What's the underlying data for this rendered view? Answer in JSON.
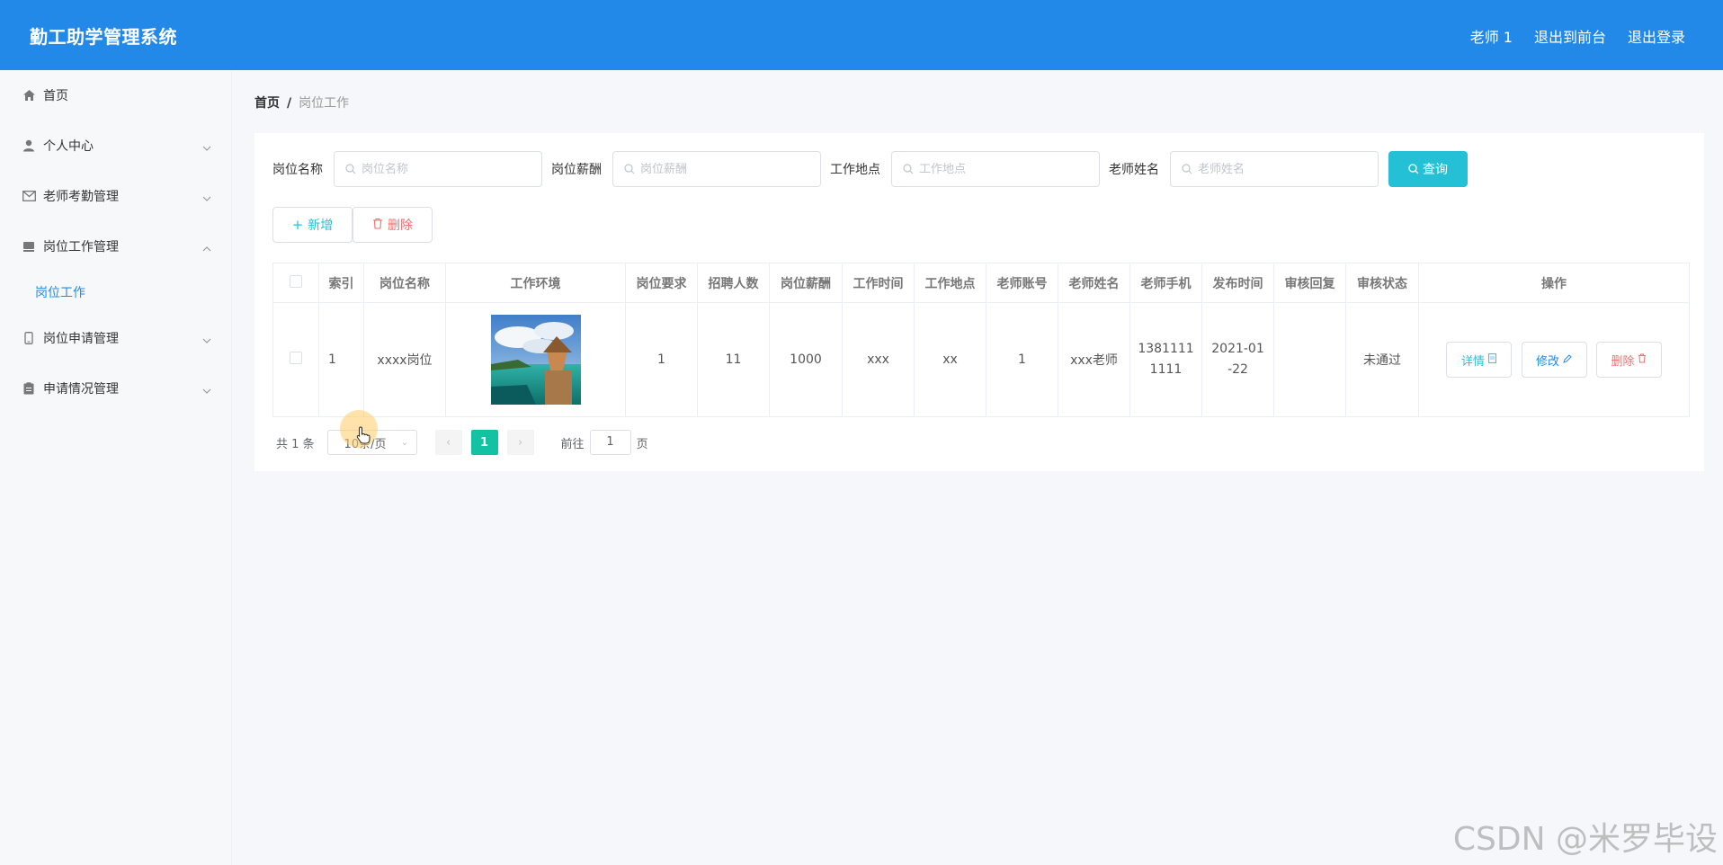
{
  "header": {
    "title": "勤工助学管理系统",
    "nav": [
      "老师 1",
      "退出到前台",
      "退出登录"
    ]
  },
  "sidebar": {
    "items": [
      {
        "label": "首页",
        "icon": "home-icon"
      },
      {
        "label": "个人中心",
        "icon": "user-icon"
      },
      {
        "label": "老师考勤管理",
        "icon": "mail-icon"
      },
      {
        "label": "岗位工作管理",
        "icon": "briefcase-icon",
        "expanded": true
      },
      {
        "label": "岗位工作",
        "icon": ""
      },
      {
        "label": "岗位申请管理",
        "icon": "phone-icon"
      },
      {
        "label": "申请情况管理",
        "icon": "clipboard-icon"
      }
    ]
  },
  "breadcrumb": {
    "home": "首页",
    "sep": "/",
    "current": "岗位工作"
  },
  "search": {
    "fields": [
      {
        "label": "岗位名称",
        "placeholder": "岗位名称"
      },
      {
        "label": "岗位薪酬",
        "placeholder": "岗位薪酬"
      },
      {
        "label": "工作地点",
        "placeholder": "工作地点"
      },
      {
        "label": "老师姓名",
        "placeholder": "老师姓名"
      }
    ],
    "query_label": "查询"
  },
  "actions": {
    "add": "新增",
    "delete": "删除"
  },
  "table": {
    "columns": [
      "",
      "索引",
      "岗位名称",
      "工作环境",
      "岗位要求",
      "招聘人数",
      "岗位薪酬",
      "工作时间",
      "工作地点",
      "老师账号",
      "老师姓名",
      "老师手机",
      "发布时间",
      "审核回复",
      "审核状态",
      "操作"
    ],
    "rows": [
      {
        "index": "1",
        "name": "xxxx岗位",
        "requirement": "1",
        "headcount": "11",
        "salary": "1000",
        "time": "xxx",
        "location": "xx",
        "account": "1",
        "teacher": "xxx老师",
        "phone_l1": "1381111",
        "phone_l2": "1111",
        "date_l1": "2021-01",
        "date_l2": "-22",
        "reply": "",
        "status": "未通过",
        "ops": {
          "detail": "详情",
          "edit": "修改",
          "remove": "删除"
        }
      }
    ]
  },
  "pager": {
    "total": "共 1 条",
    "page_size": "10条/页",
    "current": "1",
    "goto_prefix": "前往",
    "goto_value": "1",
    "goto_suffix": "页"
  },
  "watermark": "CSDN @米罗毕设",
  "colors": {
    "header": "#2389e8",
    "accent": "#24c1d6",
    "danger": "#f56c6c",
    "pager_active": "#13c2a3"
  }
}
